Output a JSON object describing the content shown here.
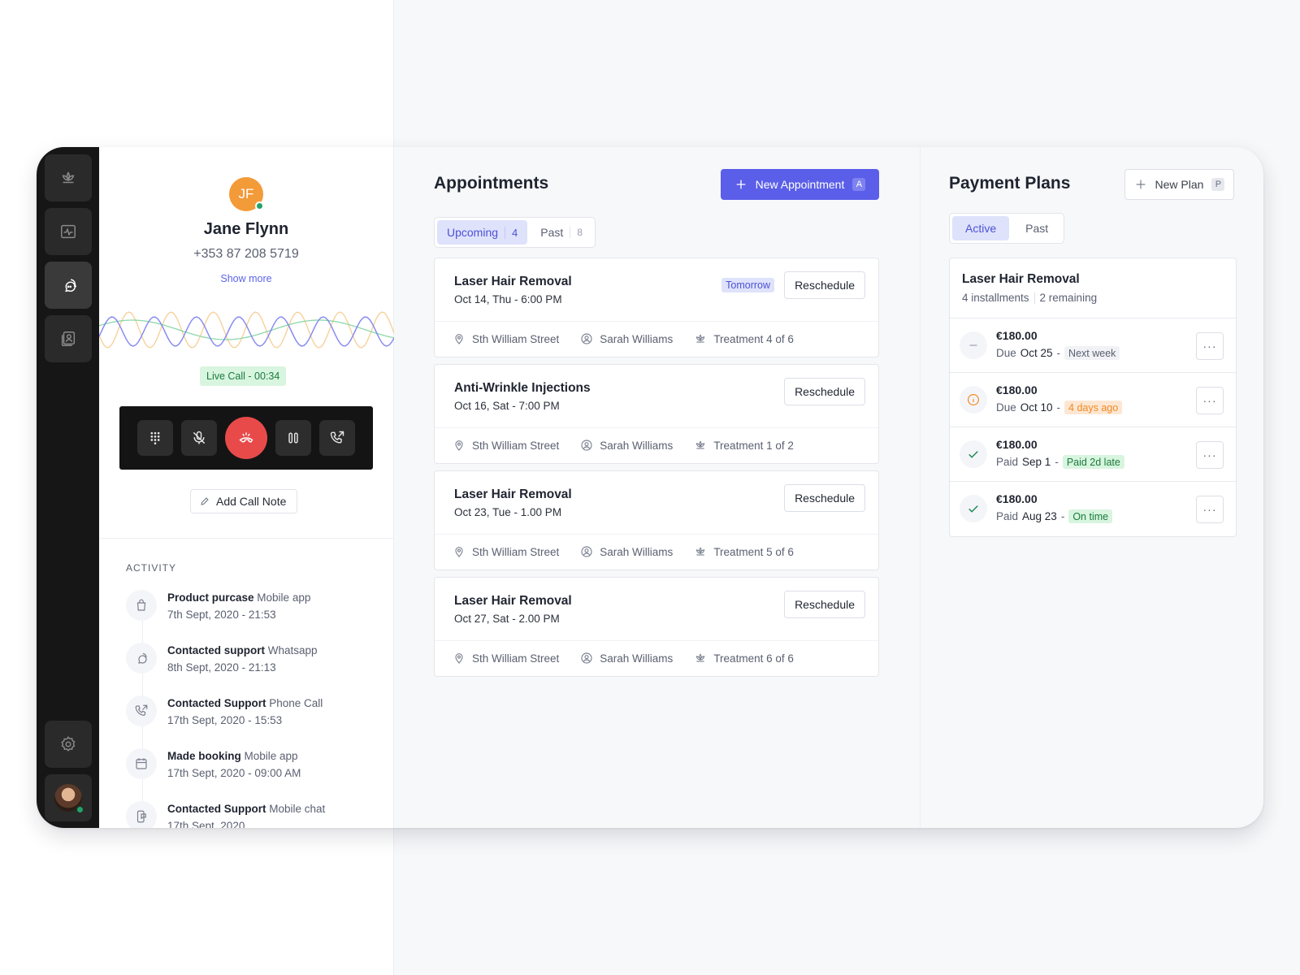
{
  "contact": {
    "initials": "JF",
    "name": "Jane Flynn",
    "phone": "+353 87 208 5719",
    "show_more": "Show more",
    "live_call": "Live Call - 00:34",
    "add_note": "Add Call Note"
  },
  "activity": {
    "title": "ACTIVITY",
    "items": [
      {
        "action": "Product purcase",
        "source": "Mobile app",
        "time": "7th Sept, 2020 - 21:53",
        "icon": "bag-icon"
      },
      {
        "action": "Contacted support",
        "source": "Whatsapp",
        "time": "8th Sept, 2020 - 21:13",
        "icon": "chat-icon"
      },
      {
        "action": "Contacted Support",
        "source": "Phone Call",
        "time": "17th Sept, 2020 - 15:53",
        "icon": "phone-icon"
      },
      {
        "action": "Made booking",
        "source": "Mobile app",
        "time": "17th Sept, 2020 - 09:00 AM",
        "icon": "calendar-icon"
      },
      {
        "action": "Contacted Support",
        "source": "Mobile chat",
        "time": "17th Sept, 2020",
        "icon": "mobile-chat-icon"
      }
    ]
  },
  "appointments": {
    "title": "Appointments",
    "new_button": "New Appointment",
    "new_kbd": "A",
    "tabs": [
      {
        "label": "Upcoming",
        "count": "4"
      },
      {
        "label": "Past",
        "count": "8"
      }
    ],
    "reschedule_label": "Reschedule",
    "items": [
      {
        "title": "Laser Hair Removal",
        "when": "Oct 14, Thu - 6:00 PM",
        "tag": "Tomorrow",
        "location": "Sth William Street",
        "staff": "Sarah Williams",
        "treatment": "Treatment 4 of 6"
      },
      {
        "title": "Anti-Wrinkle Injections",
        "when": "Oct 16, Sat - 7:00 PM",
        "tag": "",
        "location": "Sth William Street",
        "staff": "Sarah Williams",
        "treatment": "Treatment 1 of 2"
      },
      {
        "title": "Laser Hair Removal",
        "when": "Oct 23, Tue - 1.00 PM",
        "tag": "",
        "location": "Sth William Street",
        "staff": "Sarah Williams",
        "treatment": "Treatment 5 of 6"
      },
      {
        "title": "Laser Hair Removal",
        "when": "Oct 27, Sat - 2.00 PM",
        "tag": "",
        "location": "Sth William Street",
        "staff": "Sarah Williams",
        "treatment": "Treatment 6 of 6"
      }
    ]
  },
  "payment_plans": {
    "title": "Payment Plans",
    "new_button": "New Plan",
    "new_kbd": "P",
    "tabs": [
      {
        "label": "Active"
      },
      {
        "label": "Past"
      }
    ],
    "plan": {
      "title": "Laser Hair Removal",
      "installments": "4 installments",
      "remaining": "2 remaining"
    },
    "installments": [
      {
        "amount": "€180.00",
        "prefix": "Due",
        "date": "Oct 25",
        "dash": "-",
        "badge": "Next week",
        "badge_color": "grey",
        "status": "pending"
      },
      {
        "amount": "€180.00",
        "prefix": "Due",
        "date": "Oct 10",
        "dash": "-",
        "badge": "4 days ago",
        "badge_color": "orange",
        "status": "overdue"
      },
      {
        "amount": "€180.00",
        "prefix": "Paid",
        "date": "Sep 1",
        "dash": "-",
        "badge": "Paid 2d late",
        "badge_color": "green",
        "status": "paid"
      },
      {
        "amount": "€180.00",
        "prefix": "Paid",
        "date": "Aug 23",
        "dash": "-",
        "badge": "On time",
        "badge_color": "green",
        "status": "paid"
      }
    ]
  },
  "colors": {
    "accent": "#5a5ee8",
    "danger": "#e84a4a",
    "success": "#1ea46b",
    "warning": "#f08a24",
    "avatar": "#f39a39"
  }
}
